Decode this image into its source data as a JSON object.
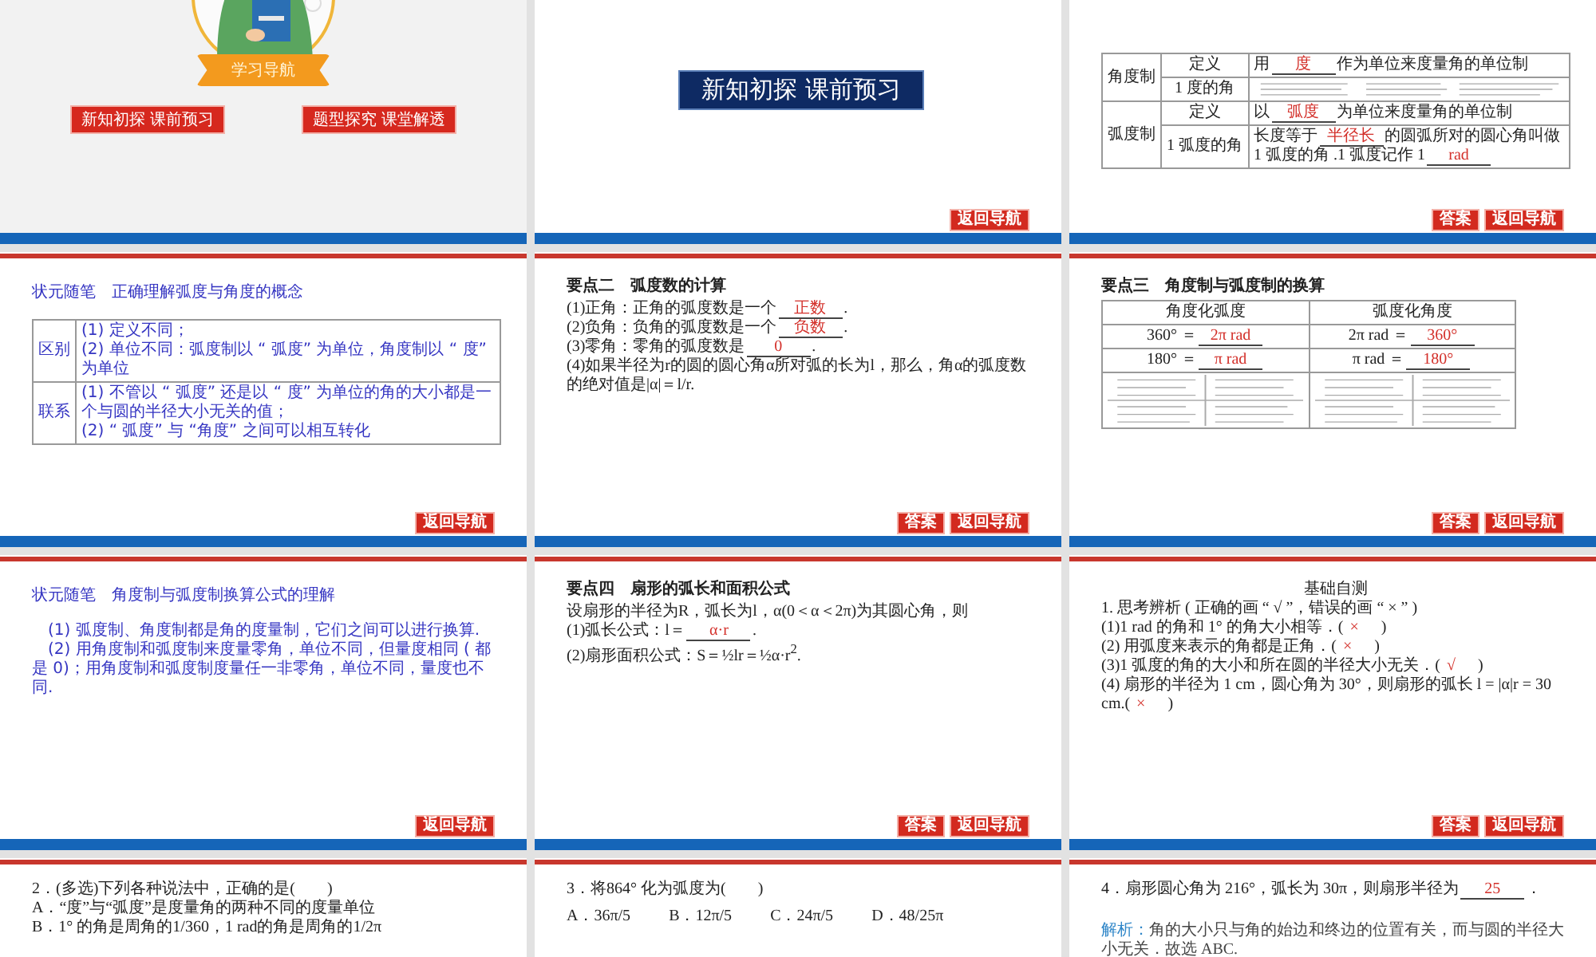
{
  "slides": [
    {
      "kind": "cover",
      "banner": "学习导航",
      "links": [
        "新知初探  课前预习",
        "题型探究  课堂解透"
      ]
    },
    {
      "kind": "section",
      "title": "新知初探  课前预习",
      "buttons": [
        "返回导航"
      ]
    },
    {
      "kind": "content",
      "blocks": [
        {
          "kind": "group-table",
          "groups": [
            {
              "label": "角度制",
              "rows": [
                [
                  {
                    "kind": "text",
                    "lines": [
                      [
                        "定义"
                      ]
                    ]
                  },
                  {
                    "kind": "text",
                    "lines": [
                      [
                        "用",
                        "度",
                        "作为单位来度量角的单位制"
                      ]
                    ]
                  }
                ],
                [
                  {
                    "kind": "text",
                    "lines": [
                      [
                        "1 度的角"
                      ]
                    ]
                  },
                  {
                    "kind": "drawing"
                  }
                ]
              ]
            },
            {
              "label": "弧度制",
              "rows": [
                [
                  {
                    "kind": "text",
                    "lines": [
                      [
                        "定义"
                      ]
                    ]
                  },
                  {
                    "kind": "text",
                    "lines": [
                      [
                        "以",
                        "弧度",
                        "为单位来度量角的单位制"
                      ]
                    ]
                  }
                ],
                [
                  {
                    "kind": "text",
                    "lines": [
                      [
                        "1 弧度的角"
                      ]
                    ]
                  },
                  {
                    "kind": "text",
                    "lines": [
                      [
                        "长度等于",
                        "半径长",
                        "的圆弧所对的圆心角叫做 1 弧度的角 .1 弧度记作 1",
                        "rad"
                      ]
                    ]
                  }
                ]
              ]
            }
          ]
        }
      ],
      "buttons": [
        "答案",
        "返回导航"
      ]
    },
    {
      "kind": "content",
      "blocks": [
        {
          "kind": "note-title",
          "text": "状元随笔　正确理解弧度与角度的概念"
        },
        {
          "kind": "group-table",
          "groups": [
            {
              "label": "区别",
              "rows": [
                [
                  {
                    "kind": "text",
                    "lines": [
                      [
                        "(1) 定义不同；"
                      ],
                      [
                        "(2) 单位不同：弧度制以 “ 弧度” 为单位，角度制以 “ 度” 为单位"
                      ]
                    ]
                  }
                ]
              ]
            },
            {
              "label": "联系",
              "rows": [
                [
                  {
                    "kind": "text",
                    "lines": [
                      [
                        "(1) 不管以 “ 弧度” 还是以 “ 度” 为单位的角的大小都是一个与圆的半径大小无关的值；"
                      ],
                      [
                        "(2) “ 弧度” 与 “角度” 之间可以相互转化"
                      ]
                    ]
                  }
                ]
              ]
            }
          ]
        }
      ],
      "buttons": [
        "返回导航"
      ]
    },
    {
      "kind": "content",
      "blocks": [
        {
          "kind": "heading",
          "text": "要点二　弧度数的计算"
        },
        {
          "kind": "line",
          "parts": [
            "(1)正角：正角的弧度数是一个",
            "正数",
            "."
          ]
        },
        {
          "kind": "line",
          "parts": [
            "(2)负角：负角的弧度数是一个",
            "负数",
            "."
          ]
        },
        {
          "kind": "line",
          "parts": [
            "(3)零角：零角的弧度数是",
            "0",
            "."
          ]
        },
        {
          "kind": "line",
          "parts": [
            "(4)如果半径为r的圆的圆心角α所对弧的长为l，那么，角α的弧度数的绝对值是|α|＝l/r."
          ]
        }
      ],
      "buttons": [
        "答案",
        "返回导航"
      ]
    },
    {
      "kind": "content",
      "blocks": [
        {
          "kind": "heading",
          "text": "要点三　角度制与弧度制的换算"
        },
        {
          "kind": "grid-table",
          "header": [
            "角度化弧度",
            "弧度化角度"
          ],
          "rows": [
            [
              {
                "kind": "text",
                "lines": [
                  [
                    "360° ＝",
                    "2π rad"
                  ]
                ]
              },
              {
                "kind": "text",
                "lines": [
                  [
                    "2π rad ＝",
                    "360°"
                  ]
                ]
              }
            ],
            [
              {
                "kind": "text",
                "lines": [
                  [
                    "180° ＝",
                    "π rad"
                  ]
                ]
              },
              {
                "kind": "text",
                "lines": [
                  [
                    "π rad ＝",
                    "180°"
                  ]
                ]
              }
            ],
            [
              {
                "kind": "drawing"
              },
              {
                "kind": "drawing"
              }
            ]
          ]
        }
      ],
      "buttons": [
        "答案",
        "返回导航"
      ]
    },
    {
      "kind": "content",
      "blocks": [
        {
          "kind": "note-title",
          "text": "状元随笔　角度制与弧度制换算公式的理解"
        },
        {
          "kind": "para",
          "text": "(1) 弧度制、角度制都是角的度量制，它们之间可以进行换算."
        },
        {
          "kind": "para",
          "text": "(2) 用角度制和弧度制来度量零角，单位不同，但量度相同 ( 都是 0)；用角度制和弧度制度量任一非零角，单位不同，量度也不同."
        }
      ],
      "buttons": [
        "返回导航"
      ]
    },
    {
      "kind": "content",
      "blocks": [
        {
          "kind": "heading",
          "text": "要点四　扇形的弧长和面积公式"
        },
        {
          "kind": "line",
          "parts": [
            "设扇形的半径为R，弧长为l，α(0＜α＜2π)为其圆心角，则"
          ]
        },
        {
          "kind": "line",
          "parts": [
            "(1)弧长公式：l＝",
            "α·r",
            "."
          ]
        },
        {
          "kind": "line",
          "parts": [
            "(2)扇形面积公式：S＝½lr＝½α·r$^{2}$."
          ]
        }
      ],
      "buttons": [
        "答案",
        "返回导航"
      ]
    },
    {
      "kind": "content",
      "blocks": [
        {
          "kind": "center-title",
          "text": "基础自测"
        },
        {
          "kind": "check",
          "parts": [
            "1. 思考辨析 ( 正确的画 “ √ ”，错误的画 “ × ” )"
          ]
        },
        {
          "kind": "check",
          "parts": [
            "(1)1 rad 的角和 1° 的角大小相等．(",
            "×",
            "　)"
          ]
        },
        {
          "kind": "check",
          "parts": [
            "(2) 用弧度来表示的角都是正角．(",
            "×",
            "　)"
          ]
        },
        {
          "kind": "check",
          "parts": [
            "(3)1 弧度的角的大小和所在圆的半径大小无关．(",
            "√",
            "　)"
          ]
        },
        {
          "kind": "check",
          "parts": [
            "(4) 扇形的半径为 1 cm，圆心角为 30°，则扇形的弧长 l = |α|r = 30 cm.(",
            "×",
            "　)"
          ]
        }
      ],
      "buttons": [
        "答案",
        "返回导航"
      ]
    },
    {
      "kind": "content",
      "blocks": [
        {
          "kind": "line",
          "parts": [
            "2．(多选)下列各种说法中，正确的是(　　)"
          ]
        },
        {
          "kind": "line",
          "parts": [
            "A．“度”与“弧度”是度量角的两种不同的度量单位"
          ]
        },
        {
          "kind": "line",
          "parts": [
            "B．1° 的角是周角的1/360，1 rad的角是周角的1/2π"
          ]
        }
      ]
    },
    {
      "kind": "content",
      "blocks": [
        {
          "kind": "line",
          "parts": [
            "3．将864° 化为弧度为(　　)"
          ]
        },
        {
          "kind": "options",
          "items": [
            "A．36π/5",
            "B．12π/5",
            "C．24π/5",
            "D．48/25π"
          ]
        }
      ]
    },
    {
      "kind": "content",
      "blocks": [
        {
          "kind": "line",
          "parts": [
            "4．扇形圆心角为 216°，弧长为 30π，则扇形半径为",
            "25",
            "．"
          ]
        },
        {
          "kind": "analysis",
          "label": "解析：",
          "text": "角的大小只与角的始边和终边的位置有关，而与圆的半径大小无关．故选 ABC."
        }
      ]
    }
  ]
}
